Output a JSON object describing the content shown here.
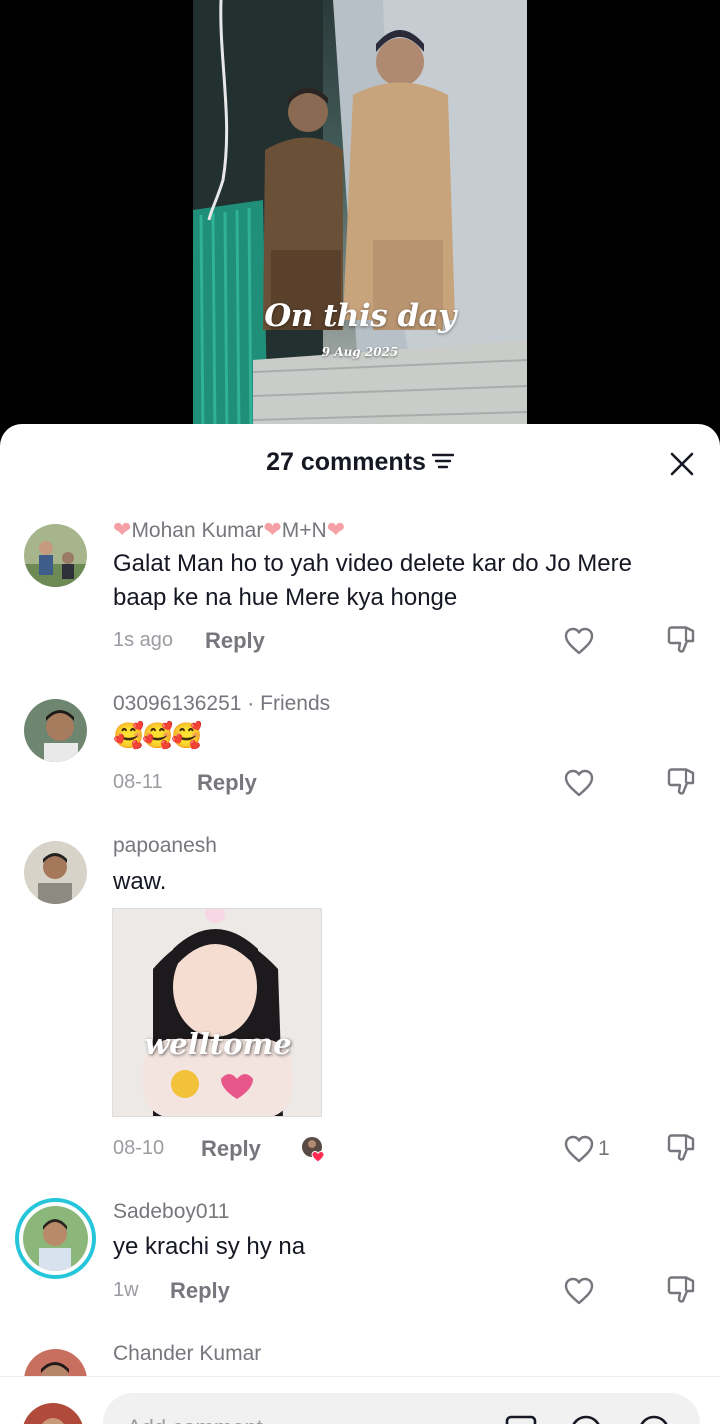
{
  "video": {
    "title": "On this day",
    "date": "9 Aug 2025"
  },
  "sheet": {
    "comment_count": "27 comments"
  },
  "comments": [
    {
      "username_parts": [
        "Mohan Kumar",
        "M+N"
      ],
      "text": "Galat Man ho to yah video delete kar do Jo Mere baap ke na hue Mere kya honge",
      "time": "1s ago",
      "reply_label": "Reply"
    },
    {
      "username": "03096136251 · Friends",
      "text": "🥰🥰🥰",
      "time": "08-11",
      "reply_label": "Reply"
    },
    {
      "username": "papoanesh",
      "text": "waw.",
      "sticker_text": "welltome",
      "time": "08-10",
      "reply_label": "Reply",
      "likes": "1"
    },
    {
      "username": "Sadeboy011",
      "text": "ye krachi sy hy na",
      "time": "1w",
      "reply_label": "Reply"
    },
    {
      "username": "Chander Kumar"
    }
  ],
  "input": {
    "placeholder": "Add comment..."
  },
  "colors": {
    "heart_accent": "#f4a0a6",
    "story_ring": "#26c6da",
    "liked_red": "#fe2c55"
  }
}
